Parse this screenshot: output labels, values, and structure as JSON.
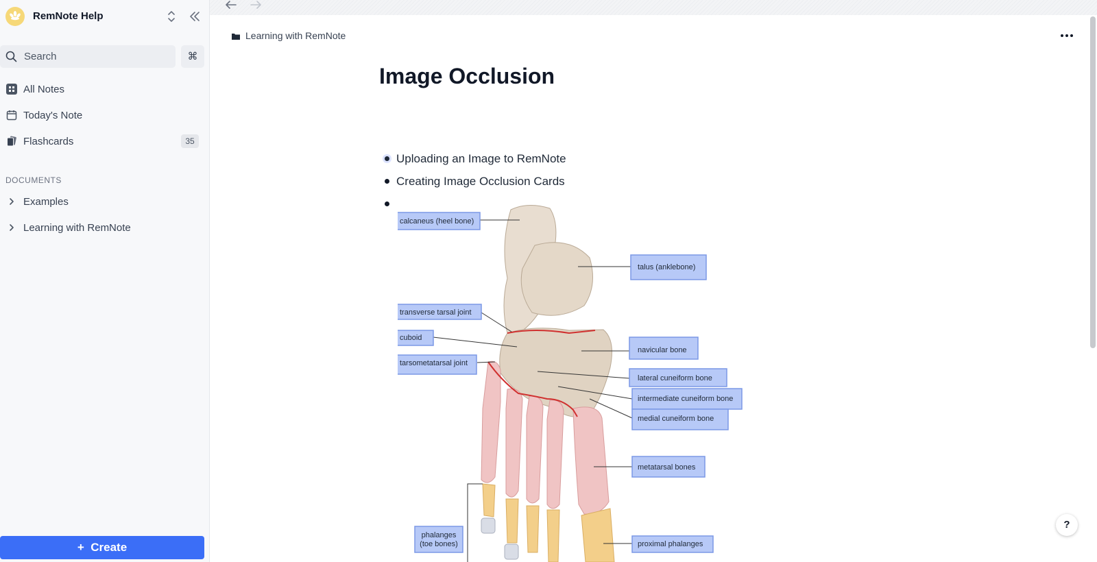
{
  "workspace": {
    "name": "RemNote Help"
  },
  "search": {
    "label": "Search",
    "shortcut": "⌘"
  },
  "nav": {
    "all_notes": "All Notes",
    "todays_note": "Today's Note",
    "flashcards": "Flashcards",
    "flashcards_count": "35"
  },
  "documents": {
    "heading": "DOCUMENTS",
    "items": [
      "Examples",
      "Learning with RemNote"
    ]
  },
  "create_label": "Create",
  "breadcrumb": {
    "label": "Learning with RemNote"
  },
  "page": {
    "title": "Image Occlusion",
    "bullets": [
      "Uploading an Image to RemNote",
      "Creating Image Occlusion Cards",
      ""
    ]
  },
  "image": {
    "labels": [
      "calcaneus (heel bone)",
      "talus (anklebone)",
      "transverse tarsal joint",
      "cuboid",
      "navicular bone",
      "tarsometatarsal joint",
      "lateral cuneiform bone",
      "intermediate cuneiform bone",
      "medial cuneiform bone",
      "metatarsal bones",
      "phalanges",
      "(toe bones)",
      "proximal phalanges"
    ]
  },
  "help_label": "?",
  "colors": {
    "accent": "#3b6ef7",
    "occlusion_fill": "#b7c9f7",
    "occlusion_border": "#7b98e6"
  }
}
